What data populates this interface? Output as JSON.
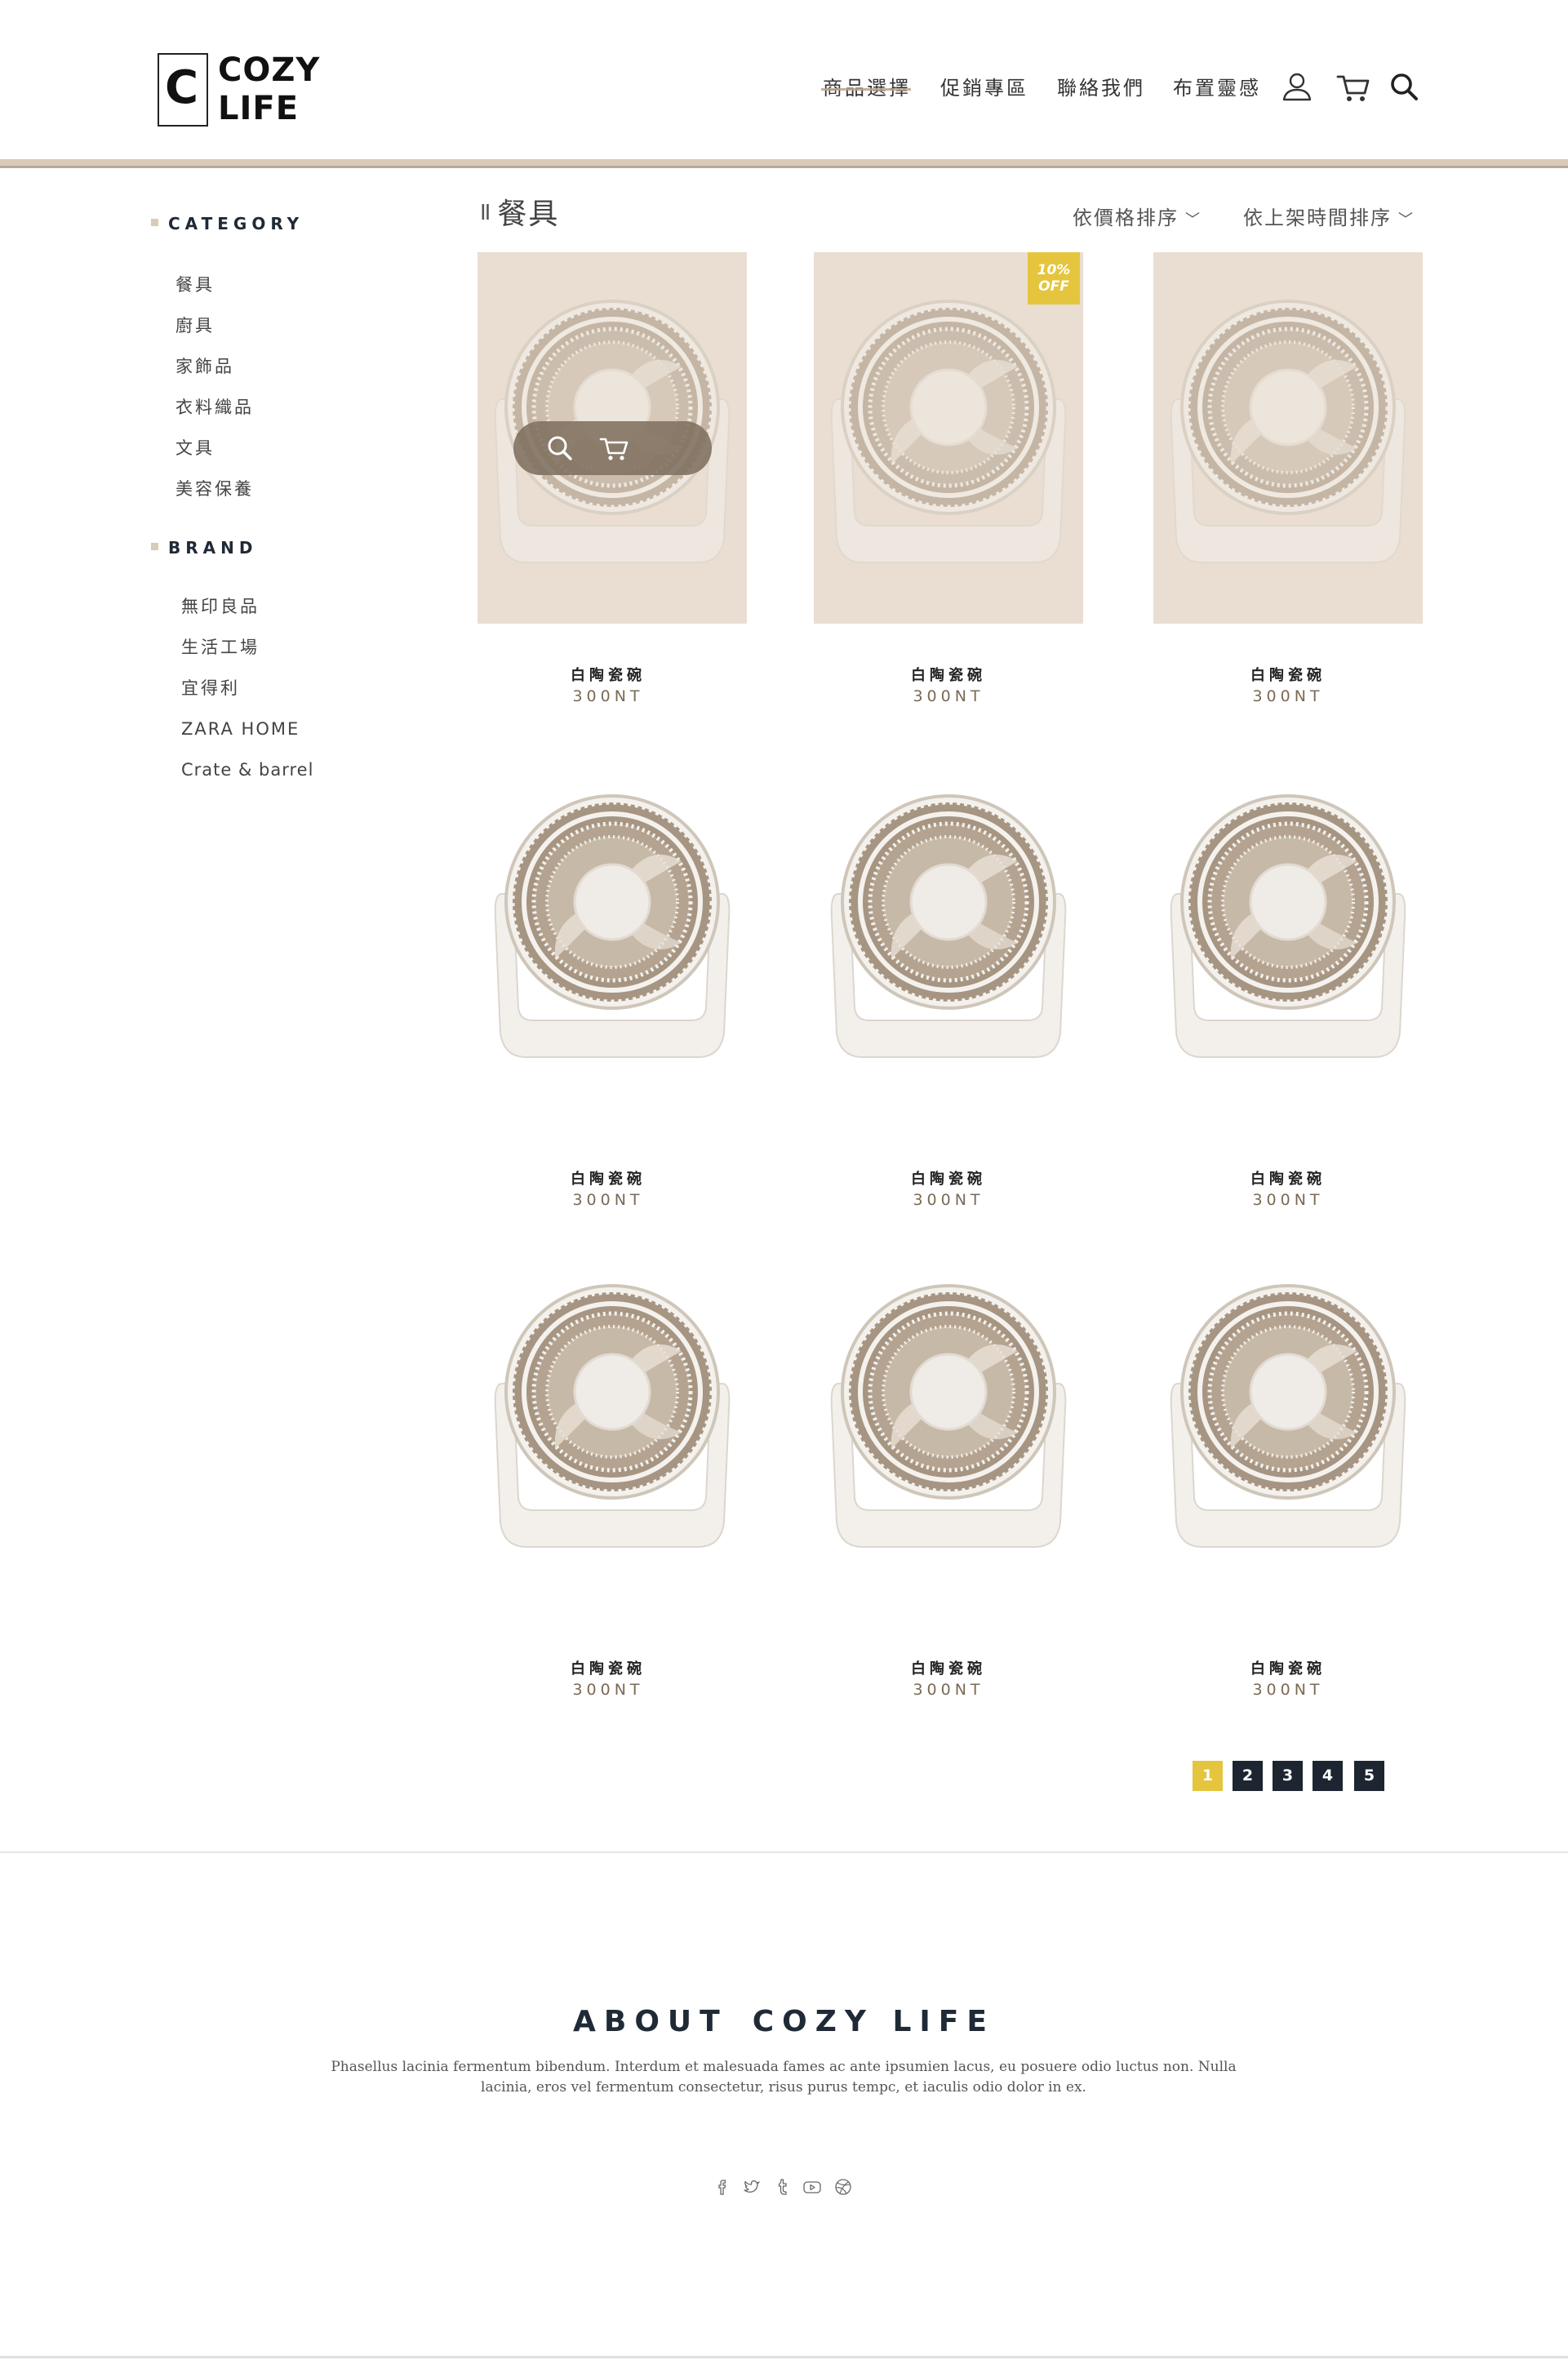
{
  "brand": {
    "logo_letter": "C",
    "logo_line1": "COZY",
    "logo_line2": "LIFE"
  },
  "nav": {
    "items": [
      {
        "label": "商品選擇",
        "active": true
      },
      {
        "label": "促銷專區",
        "active": false
      },
      {
        "label": "聯絡我們",
        "active": false
      },
      {
        "label": "布置靈感",
        "active": false
      }
    ],
    "icons": [
      "user-icon",
      "cart-icon",
      "search-icon"
    ]
  },
  "sidebar": {
    "category_heading": "CATEGORY",
    "categories": [
      "餐具",
      "廚具",
      "家飾品",
      "衣料織品",
      "文具",
      "美容保養"
    ],
    "brand_heading": "BRAND",
    "brands": [
      "無印良品",
      "生活工場",
      "宜得利",
      "ZARA HOME",
      "Crate & barrel"
    ]
  },
  "content": {
    "title_prefix": "II",
    "title": "餐具",
    "sort_price": "依價格排序",
    "sort_time": "依上架時間排序",
    "sort_chevron": "﹀"
  },
  "products": [
    {
      "name": "白陶瓷碗",
      "price": "300NT",
      "badge": "",
      "tinted": true,
      "hover": true
    },
    {
      "name": "白陶瓷碗",
      "price": "300NT",
      "badge": "10% OFF",
      "tinted": true,
      "hover": false
    },
    {
      "name": "白陶瓷碗",
      "price": "300NT",
      "badge": "",
      "tinted": true,
      "hover": false
    },
    {
      "name": "白陶瓷碗",
      "price": "300NT",
      "badge": "",
      "tinted": false,
      "hover": false
    },
    {
      "name": "白陶瓷碗",
      "price": "300NT",
      "badge": "",
      "tinted": false,
      "hover": false
    },
    {
      "name": "白陶瓷碗",
      "price": "300NT",
      "badge": "",
      "tinted": false,
      "hover": false
    },
    {
      "name": "白陶瓷碗",
      "price": "300NT",
      "badge": "",
      "tinted": false,
      "hover": false
    },
    {
      "name": "白陶瓷碗",
      "price": "300NT",
      "badge": "",
      "tinted": false,
      "hover": false
    },
    {
      "name": "白陶瓷碗",
      "price": "300NT",
      "badge": "",
      "tinted": false,
      "hover": false
    }
  ],
  "badge": {
    "line1": "10%",
    "line2": "OFF"
  },
  "pagination": {
    "pages": [
      "1",
      "2",
      "3",
      "4",
      "5"
    ],
    "current": "1"
  },
  "footer": {
    "about_word": "ABOUT",
    "about_brand": "COZY LIFE",
    "text": "Phasellus lacinia fermentum bibendum. Interdum et malesuada fames ac ante ipsumien lacus, eu posuere odio luctus non. Nulla lacinia, eros vel fermentum consectetur, risus purus tempc, et iaculis odio dolor in ex.",
    "socials": [
      "facebook-icon",
      "twitter-icon",
      "tumblr-icon",
      "youtube-icon",
      "dribbble-icon"
    ]
  },
  "colors": {
    "accent_beige": "#d9cbb6",
    "tile_bg": "#e9ded1",
    "badge_yellow": "#e4c53d",
    "dark_navy": "#1d2530",
    "price_brown": "#7a6a55"
  }
}
